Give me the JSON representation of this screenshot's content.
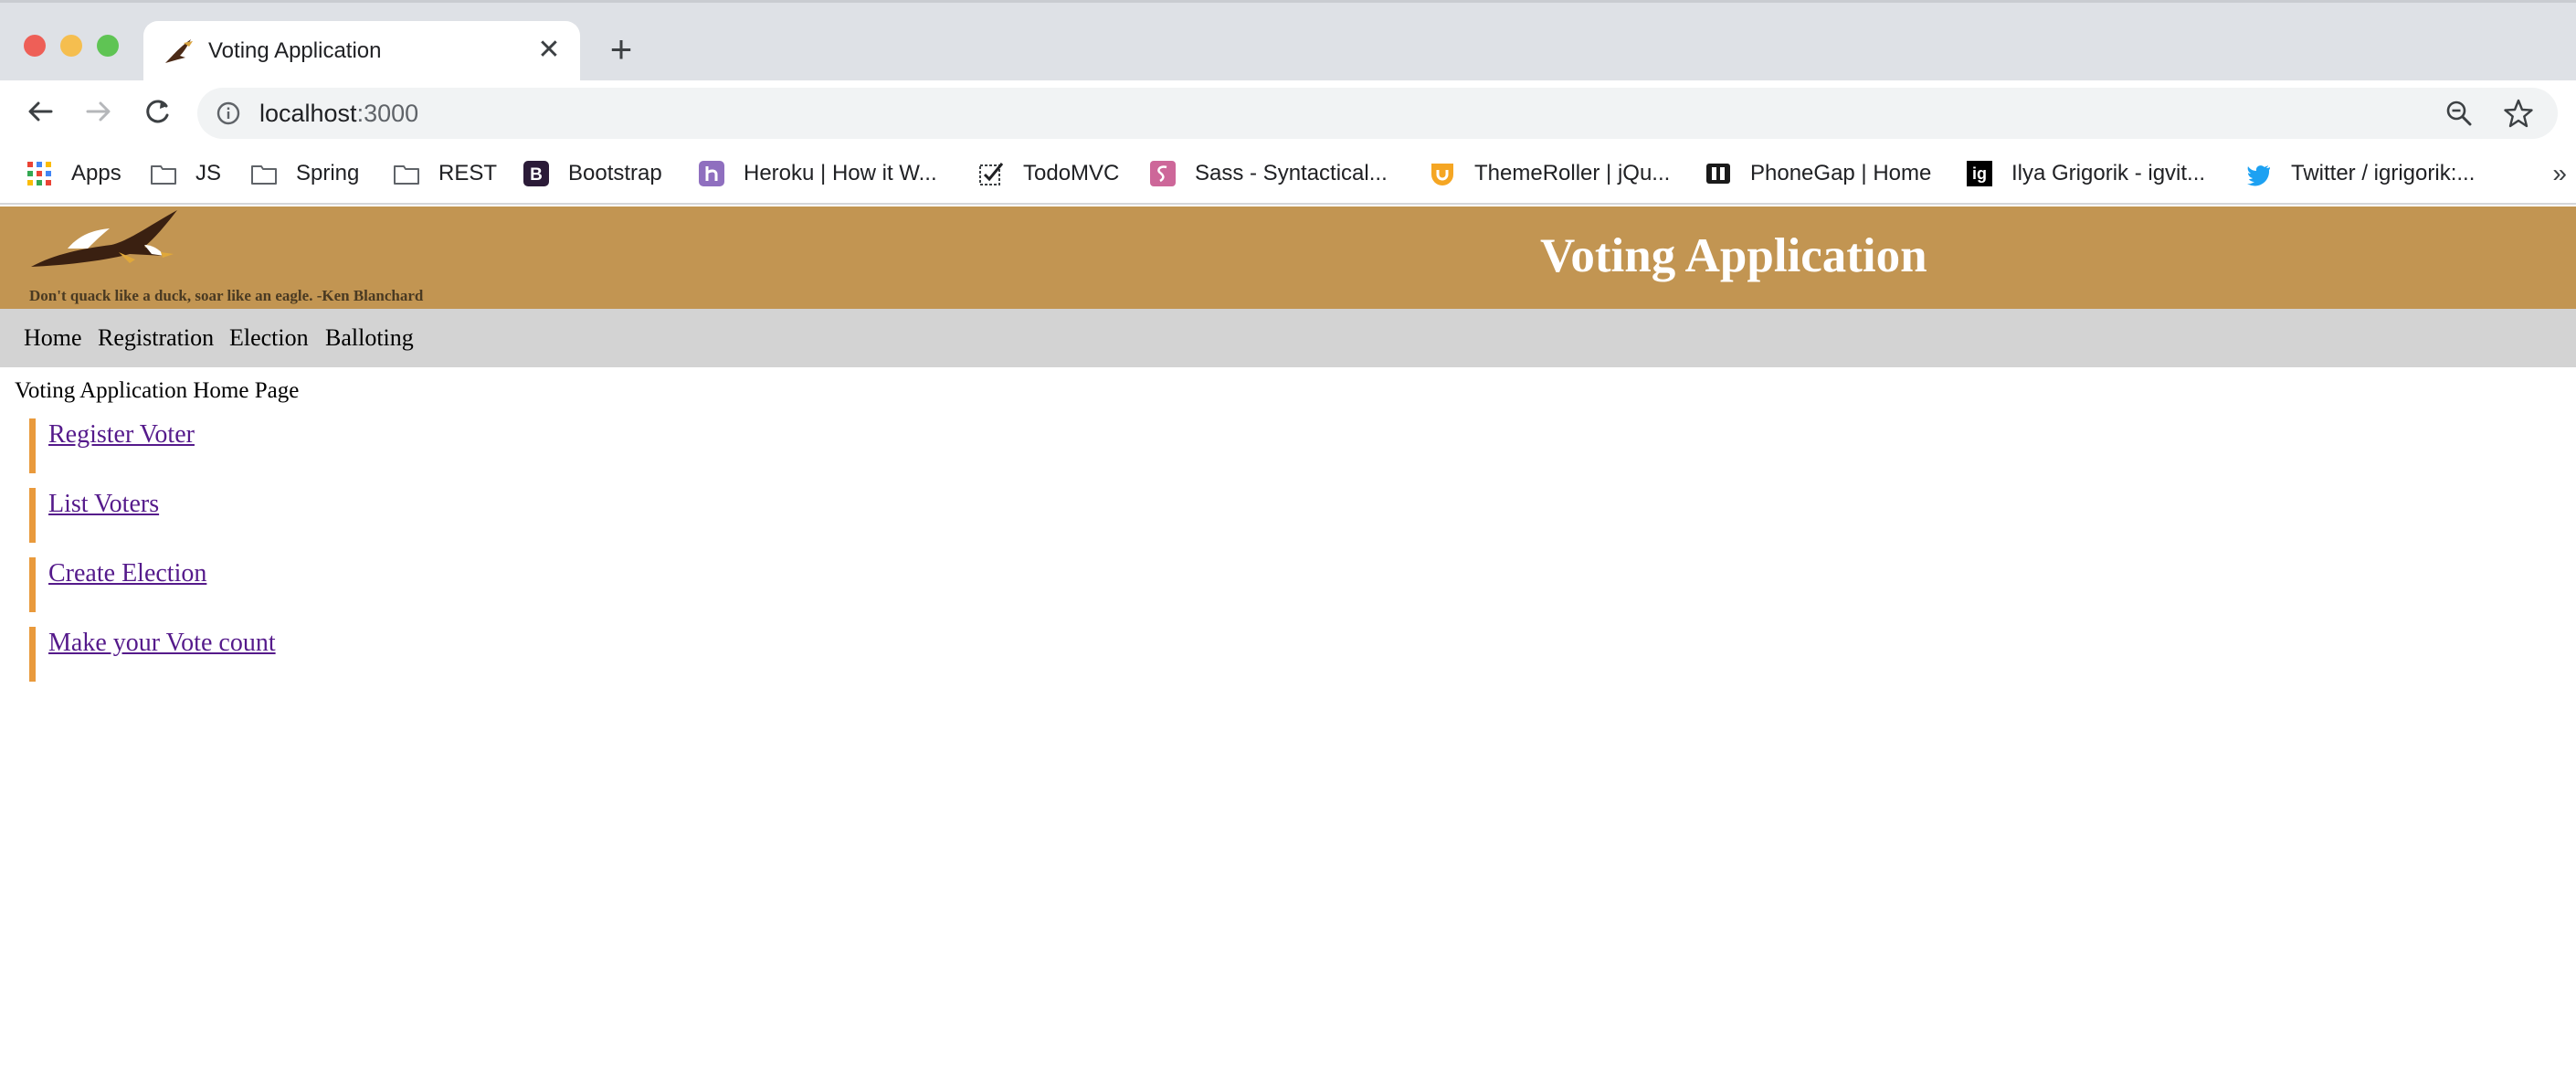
{
  "browser": {
    "tab": {
      "title": "Voting Application",
      "close_glyph": "✕",
      "favicon": "eagle-icon"
    },
    "new_tab_glyph": "+",
    "address": {
      "host": "localhost",
      "port": ":3000"
    },
    "bookmarks": [
      {
        "label": "Apps",
        "icon": "apps-grid-icon"
      },
      {
        "label": "JS",
        "icon": "folder-icon"
      },
      {
        "label": "Spring",
        "icon": "folder-icon"
      },
      {
        "label": "REST",
        "icon": "folder-icon"
      },
      {
        "label": "Bootstrap",
        "icon": "bootstrap-icon"
      },
      {
        "label": "Heroku | How it W...",
        "icon": "heroku-icon"
      },
      {
        "label": "TodoMVC",
        "icon": "checkbox-icon"
      },
      {
        "label": "Sass - Syntactical...",
        "icon": "sass-icon"
      },
      {
        "label": "ThemeRoller | jQu...",
        "icon": "themeroller-icon"
      },
      {
        "label": "PhoneGap | Home",
        "icon": "phonegap-icon"
      },
      {
        "label": "Ilya Grigorik - igvit...",
        "icon": "ig-icon"
      },
      {
        "label": "Twitter / igrigorik:...",
        "icon": "twitter-icon"
      }
    ],
    "bookmarks_more_glyph": "»"
  },
  "site": {
    "title": "Voting Application",
    "quote": "Don't quack like a duck, soar like an eagle. -Ken Blanchard",
    "nav": [
      "Home",
      "Registration",
      "Election",
      "Balloting"
    ],
    "heading": "Voting Application Home Page",
    "links": [
      "Register Voter",
      "List Voters",
      "Create Election",
      "Make your Vote count"
    ]
  },
  "colors": {
    "header_bg": "#c29552",
    "nav_bg": "#d3d3d3",
    "link_accent": "#e99a3c",
    "visited_link": "#551a8b"
  }
}
